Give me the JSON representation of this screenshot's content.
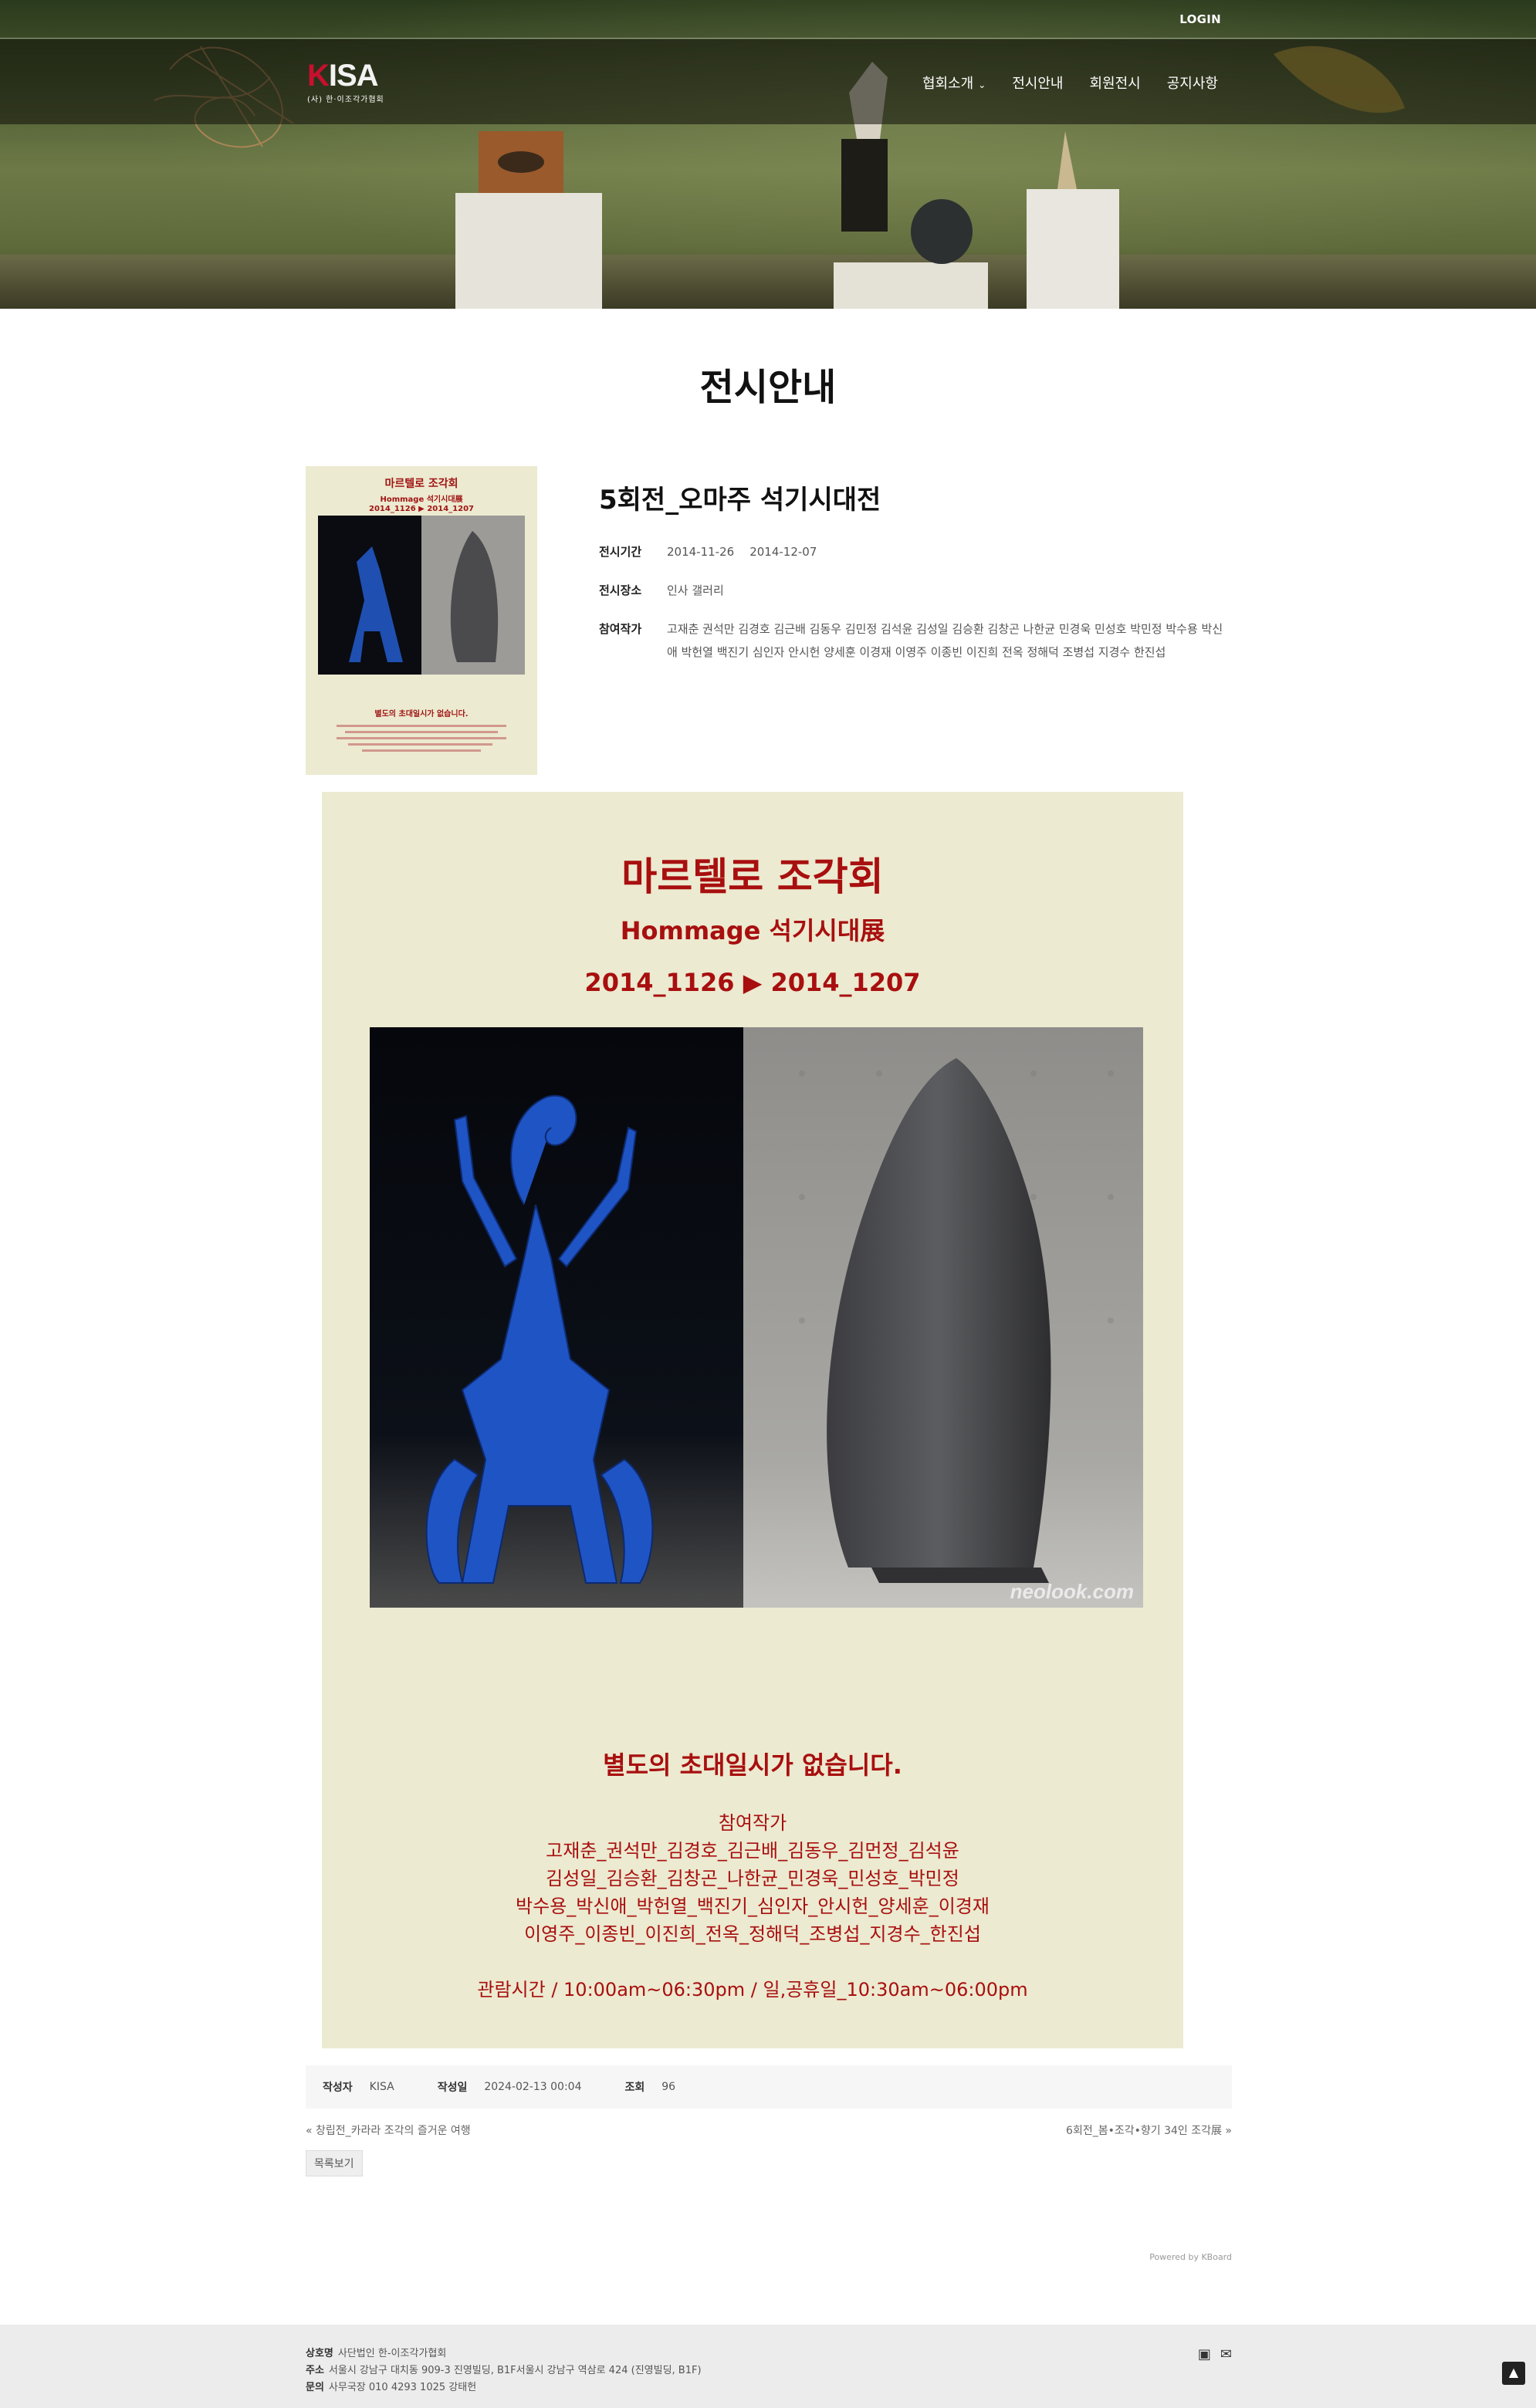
{
  "header": {
    "login_label": "LOGIN",
    "logo_mark": "KISA",
    "logo_sub": "(사) 한·이조각가협회",
    "nav": [
      {
        "label": "협회소개",
        "has_dropdown": true
      },
      {
        "label": "전시안내"
      },
      {
        "label": "회원전시"
      },
      {
        "label": "공지사항"
      }
    ]
  },
  "page": {
    "title": "전시안내"
  },
  "post": {
    "title": "5회전_오마주 석기시대전",
    "period_label": "전시기간",
    "period_start": "2014-11-26",
    "period_end": "2014-12-07",
    "place_label": "전시장소",
    "place": "인사 갤러리",
    "artists_label": "참여작가",
    "artists": "고재춘 권석만 김경호 김근배 김동우 김민정 김석윤 김성일 김승환 김창곤 나한균 민경욱 민성호 박민정 박수용 박신애 박헌열 백진기 심인자 안시헌 양세훈 이경재 이영주 이종빈 이진희 전옥 정해덕 조병섭 지경수 한진섭"
  },
  "poster": {
    "title": "마르텔로 조각회",
    "subtitle": "Hommage 석기시대展",
    "date": "2014_1126 ▶ 2014_1207",
    "watermark": "neolook.com",
    "notice": "별도의 초대일시가 없습니다.",
    "artists_head": "참여작가",
    "artist_lines": [
      "고재춘_권석만_김경호_김근배_김동우_김먼정_김석윤",
      "김성일_김승환_김창곤_나한균_민경욱_민성호_박민정",
      "박수용_박신애_박헌열_백진기_심인자_안시헌_양세훈_이경재",
      "이영주_이종빈_이진희_전옥_정해덕_조병섭_지경수_한진섭"
    ],
    "hours": "관람시간 / 10:00am~06:30pm / 일,공휴일_10:30am~06:00pm"
  },
  "info": {
    "author_label": "작성자",
    "author": "KISA",
    "date_label": "작성일",
    "date": "2024-02-13 00:04",
    "views_label": "조회",
    "views": "96"
  },
  "navigation": {
    "prev": "«  창립전_카라라 조각의 즐거운 여행",
    "next": "6회전_봄•조각•향기 34인 조각展  »",
    "list_button": "목록보기",
    "powered": "Powered by KBoard"
  },
  "footer": {
    "company_label": "상호명",
    "company": "사단법인 한-이조각가협회",
    "address_label": "주소",
    "address": "서울시 강남구 대치동 909-3 진영빌딩, B1F서울시 강남구 역삼로 424 (진영빌딩, B1F)",
    "contact_label": "문의",
    "contact": "사무국장 010 4293 1025 강태헌",
    "icons": [
      "instagram-icon",
      "mail-icon"
    ]
  },
  "colors": {
    "poster_bg": "#ecead0",
    "poster_text": "#a80f0f",
    "logo_accent": "#c8102e"
  }
}
